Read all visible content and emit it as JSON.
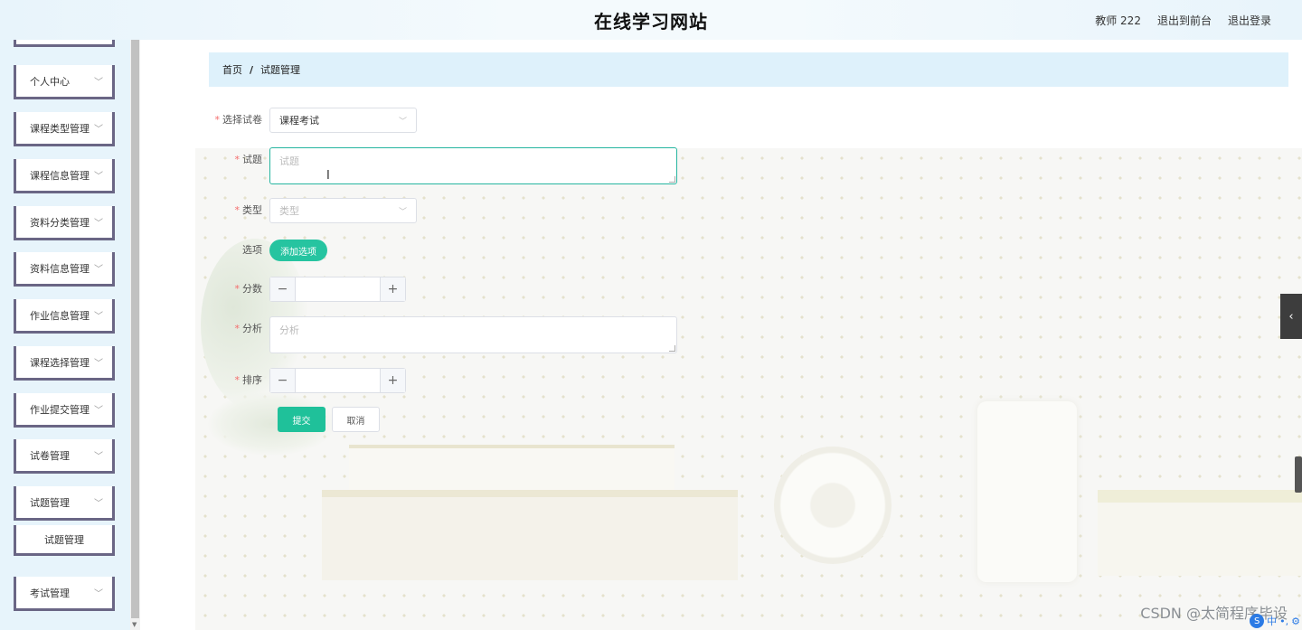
{
  "header": {
    "title": "在线学习网站",
    "user": "教师 222",
    "exit_front": "退出到前台",
    "logout": "退出登录"
  },
  "sidebar": {
    "items": [
      {
        "label": "个人中心"
      },
      {
        "label": "课程类型管理"
      },
      {
        "label": "课程信息管理"
      },
      {
        "label": "资料分类管理"
      },
      {
        "label": "资料信息管理"
      },
      {
        "label": "作业信息管理"
      },
      {
        "label": "课程选择管理"
      },
      {
        "label": "作业提交管理"
      },
      {
        "label": "试卷管理"
      },
      {
        "label": "试题管理"
      },
      {
        "label": "考试管理"
      }
    ],
    "submenu_label": "试题管理"
  },
  "breadcrumb": {
    "home": "首页",
    "separator": "/",
    "current": "试题管理"
  },
  "form": {
    "paper_label": "选择试卷",
    "paper_value": "课程考试",
    "question_label": "试题",
    "question_placeholder": "试题",
    "type_label": "类型",
    "type_placeholder": "类型",
    "options_label": "选项",
    "add_option": "添加选项",
    "score_label": "分数",
    "analysis_label": "分析",
    "analysis_placeholder": "分析",
    "order_label": "排序",
    "required_mark": "*",
    "stepper_minus": "−",
    "stepper_plus": "+",
    "submit": "提交",
    "cancel": "取消"
  },
  "watermark": "CSDN @太简程序毕设",
  "colors": {
    "accent": "#1fc19a",
    "breadcrumb_bg": "#def1fb",
    "menu_border": "#6a6685",
    "required": "#f56c6c"
  }
}
